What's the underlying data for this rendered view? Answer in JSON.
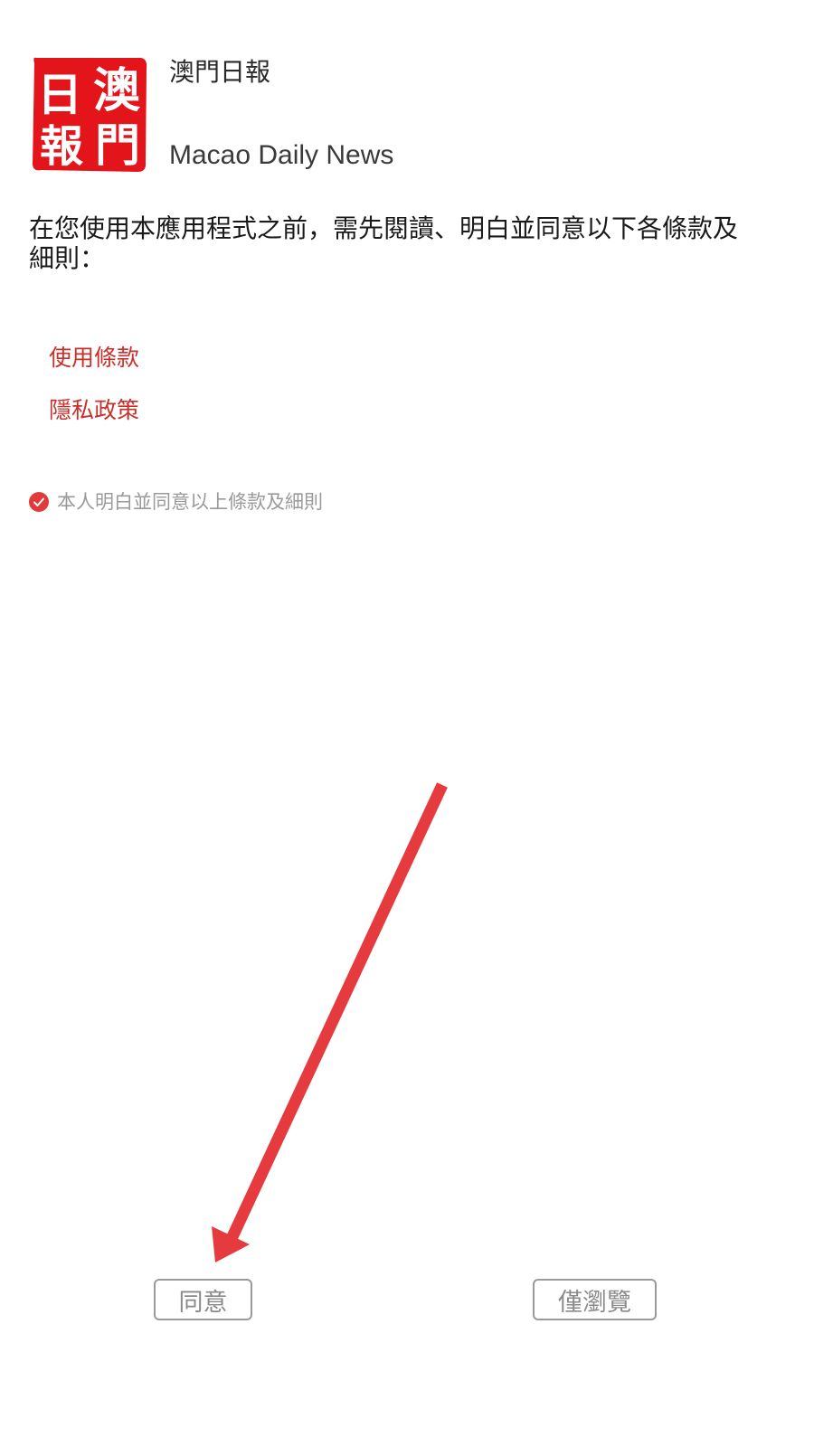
{
  "app": {
    "name_zh": "澳門日報",
    "name_en": "Macao Daily News",
    "logo_icon": "macao-daily-seal-logo",
    "logo_glyphs": [
      "日",
      "澳",
      "報",
      "門"
    ]
  },
  "intro": {
    "text": "在您使用本應用程式之前，需先閱讀、明白並同意以下各條款及細則："
  },
  "links": {
    "terms": "使用條款",
    "privacy": "隱私政策"
  },
  "consent": {
    "label": "本人明白並同意以上條款及細則",
    "checked": true,
    "icon": "check-circle-icon"
  },
  "buttons": {
    "agree": "同意",
    "browse_only": "僅瀏覽"
  },
  "colors": {
    "brand_red": "#e3141a",
    "link_red": "#c9302c",
    "arrow_red": "#e53a3e",
    "button_border": "#9a9a9a"
  }
}
